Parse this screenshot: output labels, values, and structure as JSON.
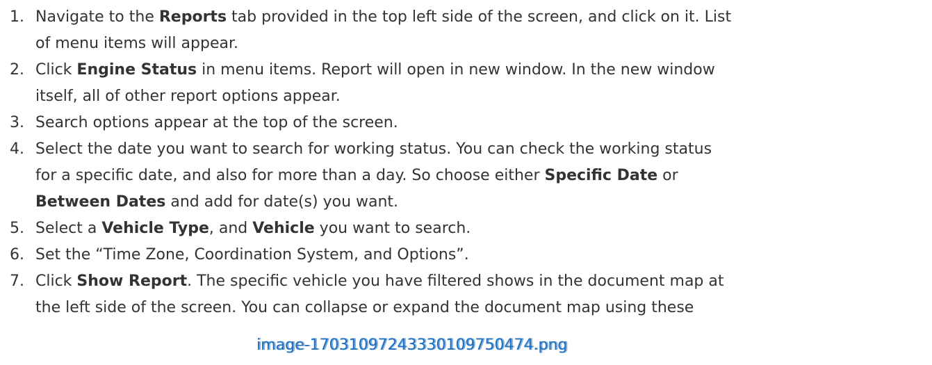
{
  "steps": [
    {
      "num": "1.",
      "l1a": "Navigate to the ",
      "l1b": "Reports",
      "l1c": " tab provided in the top left side of the screen, and click on it. List",
      "l2": "of menu items will appear."
    },
    {
      "num": "2.",
      "l1a": "Click ",
      "l1b": "Engine Status",
      "l1c": " in menu items. Report will open in new window. In the new window",
      "l2": "itself, all of other report options appear."
    },
    {
      "num": "3.",
      "l1": "Search options appear at the top of the screen."
    },
    {
      "num": "4.",
      "l1": "Select the date you want to search for working status. You can check the working status",
      "l2a": "for a specific date, and also for more than a day. So choose either ",
      "l2b": "Specific Date",
      "l2c": " or",
      "l3a": "Between Dates",
      "l3b": " and add for date(s) you want."
    },
    {
      "num": "5.",
      "a": "Select a ",
      "b": "Vehicle Type",
      "c": ", and ",
      "d": "Vehicle",
      "e": " you want to search."
    },
    {
      "num": "6.",
      "l1": "Set the “Time Zone, Coordination System, and Options”."
    },
    {
      "num": "7.",
      "l1a": "Click ",
      "l1b": "Show Report",
      "l1c": ". The specific vehicle you have filtered shows in the document map at",
      "l2": "the left side of the screen. You can collapse or expand the document map using these"
    }
  ],
  "caption": "image-17031097243330109750474.png",
  "caption_under": "image-17031097243330109750474.png",
  "link_color": "#1f70c1"
}
